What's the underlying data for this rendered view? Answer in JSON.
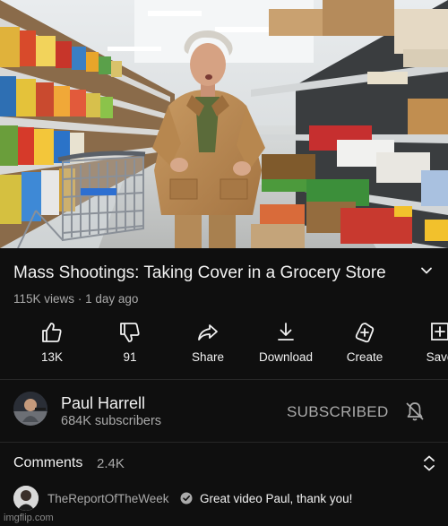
{
  "video": {
    "title": "Mass Shootings: Taking Cover in a Grocery Store",
    "views": "115K views",
    "separator": "·",
    "age": "1 day ago"
  },
  "actions": [
    {
      "icon": "thumbs-up-icon",
      "label": "13K"
    },
    {
      "icon": "thumbs-down-icon",
      "label": "91"
    },
    {
      "icon": "share-icon",
      "label": "Share"
    },
    {
      "icon": "download-icon",
      "label": "Download"
    },
    {
      "icon": "create-icon",
      "label": "Create"
    },
    {
      "icon": "save-to-playlist-icon",
      "label": "Save"
    }
  ],
  "channel": {
    "name": "Paul Harrell",
    "subscribers": "684K subscribers",
    "subscribe_state": "SUBSCRIBED",
    "bell_icon": "bell-off-icon"
  },
  "comments": {
    "label": "Comments",
    "count": "2.4K",
    "top_comment": {
      "author": "TheReportOfTheWeek",
      "verified": true,
      "text": "Great video Paul, thank you!"
    }
  },
  "watermark": "imgflip.com",
  "colors": {
    "background": "#0f0f0f",
    "primary_text": "#f1f1f1",
    "secondary_text": "#aaaaaa",
    "divider": "#272727"
  }
}
